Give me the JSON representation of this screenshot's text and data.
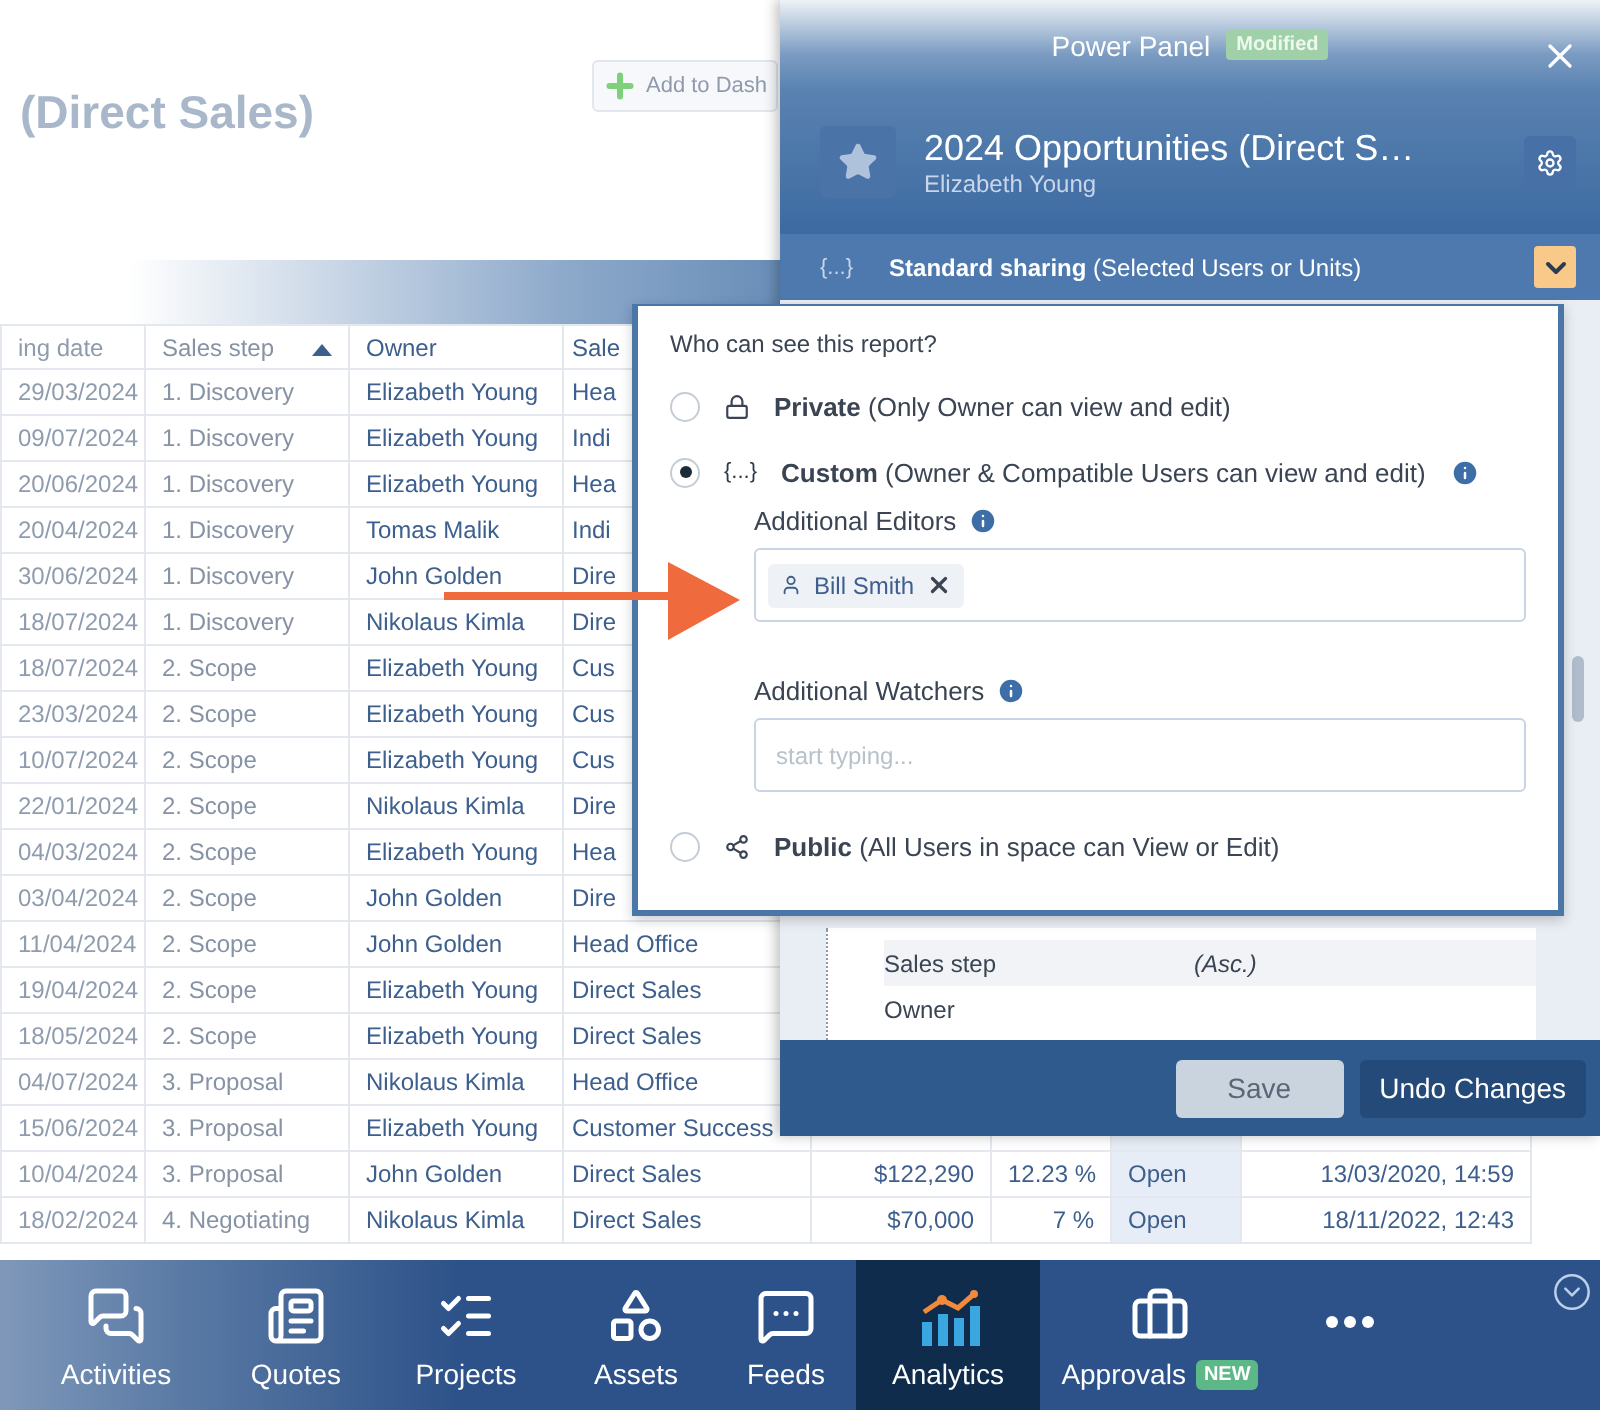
{
  "page": {
    "title": "(Direct Sales)",
    "add_button": "Add to Dash"
  },
  "table": {
    "columns": [
      {
        "label": "ing date",
        "sorted": false
      },
      {
        "label": "Sales step",
        "sorted": true
      },
      {
        "label": "Owner",
        "sorted": false
      },
      {
        "label": "Sale",
        "sorted": false
      }
    ],
    "rows": [
      {
        "date": "29/03/2024",
        "step": "1. Discovery",
        "owner": "Elizabeth Young",
        "unit": "Hea"
      },
      {
        "date": "09/07/2024",
        "step": "1. Discovery",
        "owner": "Elizabeth Young",
        "unit": "Indi"
      },
      {
        "date": "20/06/2024",
        "step": "1. Discovery",
        "owner": "Elizabeth Young",
        "unit": "Hea"
      },
      {
        "date": "20/04/2024",
        "step": "1. Discovery",
        "owner": "Tomas Malik",
        "unit": "Indi"
      },
      {
        "date": "30/06/2024",
        "step": "1. Discovery",
        "owner": "John Golden",
        "unit": "Dire"
      },
      {
        "date": "18/07/2024",
        "step": "1. Discovery",
        "owner": "Nikolaus Kimla",
        "unit": "Dire"
      },
      {
        "date": "18/07/2024",
        "step": "2. Scope",
        "owner": "Elizabeth Young",
        "unit": "Cus"
      },
      {
        "date": "23/03/2024",
        "step": "2. Scope",
        "owner": "Elizabeth Young",
        "unit": "Cus"
      },
      {
        "date": "10/07/2024",
        "step": "2. Scope",
        "owner": "Elizabeth Young",
        "unit": "Cus"
      },
      {
        "date": "22/01/2024",
        "step": "2. Scope",
        "owner": "Nikolaus Kimla",
        "unit": "Dire"
      },
      {
        "date": "04/03/2024",
        "step": "2. Scope",
        "owner": "Elizabeth Young",
        "unit": "Hea"
      },
      {
        "date": "03/04/2024",
        "step": "2. Scope",
        "owner": "John Golden",
        "unit": "Dire"
      },
      {
        "date": "11/04/2024",
        "step": "2. Scope",
        "owner": "John Golden",
        "unit": "Head Office"
      },
      {
        "date": "19/04/2024",
        "step": "2. Scope",
        "owner": "Elizabeth Young",
        "unit": "Direct Sales"
      },
      {
        "date": "18/05/2024",
        "step": "2. Scope",
        "owner": "Elizabeth Young",
        "unit": "Direct Sales"
      },
      {
        "date": "04/07/2024",
        "step": "3. Proposal",
        "owner": "Nikolaus Kimla",
        "unit": "Head Office"
      },
      {
        "date": "15/06/2024",
        "step": "3. Proposal",
        "owner": "Elizabeth Young",
        "unit": "Customer Success"
      },
      {
        "date": "10/04/2024",
        "step": "3. Proposal",
        "owner": "John Golden",
        "unit": "Direct Sales",
        "amount": "$122,290",
        "percent": "12.23 %",
        "status": "Open",
        "closed": "13/03/2020, 14:59"
      },
      {
        "date": "18/02/2024",
        "step": "4. Negotiating",
        "owner": "Nikolaus Kimla",
        "unit": "Direct Sales",
        "amount": "$70,000",
        "percent": "7 %",
        "status": "Open",
        "closed": "18/11/2022, 12:43"
      }
    ]
  },
  "panel": {
    "title": "Power Panel",
    "badge": "Modified",
    "report_title": "2024 Opportunities (Direct S…",
    "owner": "Elizabeth Young",
    "sharing": {
      "symbol": "{...}",
      "text": "**Standard sharing** (Selected Users or Units)",
      "expanded": true
    },
    "sort_items": [
      {
        "label": "Sales step",
        "order": "(Asc.)"
      },
      {
        "label": "Owner"
      }
    ],
    "buttons": [
      {
        "label": "Save",
        "kind": "secondary"
      },
      {
        "label": "Undo Changes",
        "kind": "primary"
      }
    ]
  },
  "sharing_popup": {
    "question": "Who can see this report?",
    "options": [
      {
        "kind": "private",
        "title": "Private",
        "detail": "(Only Owner can view and edit)",
        "selected": false
      },
      {
        "kind": "custom",
        "symbol": "{...}",
        "title": "Custom",
        "detail": "(Owner & Compatible Users can view and edit)",
        "selected": true,
        "info": true
      },
      {
        "kind": "public",
        "title": "Public",
        "detail": "(All Users in space can View or Edit)",
        "selected": false
      }
    ],
    "editors": {
      "label": "Additional Editors",
      "chips": [
        "Bill Smith"
      ]
    },
    "watchers": {
      "label": "Additional Watchers",
      "placeholder": "start typing..."
    }
  },
  "nav": {
    "items": [
      {
        "label": "Activities",
        "selected": false
      },
      {
        "label": "Quotes",
        "selected": false
      },
      {
        "label": "Projects",
        "selected": false
      },
      {
        "label": "Assets",
        "selected": false
      },
      {
        "label": "Feeds",
        "selected": false
      },
      {
        "label": "Analytics",
        "selected": true
      },
      {
        "label": "Approvals",
        "selected": false,
        "badge": "NEW"
      }
    ]
  }
}
